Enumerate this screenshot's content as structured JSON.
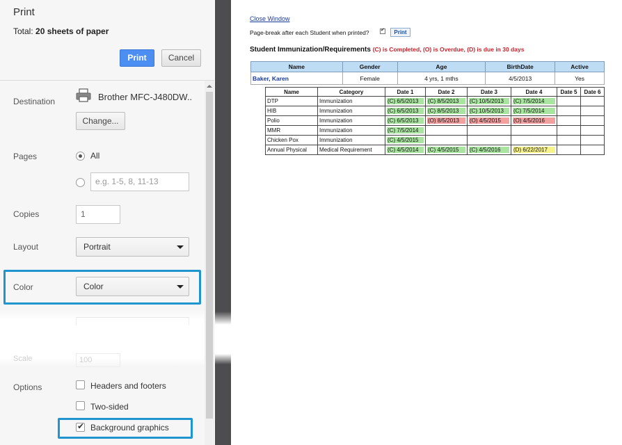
{
  "dialog": {
    "title": "Print",
    "total_prefix": "Total: ",
    "total_value": "20 sheets of paper",
    "print_button": "Print",
    "cancel_button": "Cancel",
    "destination": {
      "label": "Destination",
      "printer_name": "Brother MFC-J480DW..",
      "change_button": "Change..."
    },
    "pages": {
      "label": "Pages",
      "all_label": "All",
      "custom_placeholder": "e.g. 1-5, 8, 11-13"
    },
    "copies": {
      "label": "Copies",
      "value": "1"
    },
    "layout": {
      "label": "Layout",
      "value": "Portrait"
    },
    "color": {
      "label": "Color",
      "value": "Color"
    },
    "scale": {
      "label": "Scale",
      "value": "100"
    },
    "options": {
      "label": "Options",
      "headers_footers": "Headers and footers",
      "two_sided": "Two-sided",
      "background_graphics": "Background graphics"
    }
  },
  "preview": {
    "close_window": "Close Window",
    "pagebreak_label": "Page-break after each Student when printed?",
    "print_button": "Print",
    "report_title": "Student Immunization/Requirements",
    "legend": "(C) is Completed, (O) is Overdue, (D) is due in 30 days",
    "student_headers": [
      "Name",
      "Gender",
      "Age",
      "BirthDate",
      "Active"
    ],
    "student": {
      "name": "Baker, Karen",
      "gender": "Female",
      "age": "4 yrs, 1 mths",
      "birthdate": "4/5/2013",
      "active": "Yes"
    },
    "imm_headers": [
      "Name",
      "Category",
      "Date 1",
      "Date 2",
      "Date 3",
      "Date 4",
      "Date 5",
      "Date 6"
    ],
    "imm_rows": [
      {
        "name": "DTP",
        "category": "Immunization",
        "dates": [
          "(C) 6/5/2013",
          "(C) 8/5/2013",
          "(C) 10/5/2013",
          "(C) 7/5/2014",
          "",
          ""
        ],
        "status": [
          "c",
          "c",
          "c",
          "c",
          "",
          ""
        ]
      },
      {
        "name": "HIB",
        "category": "Immunization",
        "dates": [
          "(C) 6/5/2013",
          "(C) 8/5/2013",
          "(C) 10/5/2013",
          "(C) 7/5/2014",
          "",
          ""
        ],
        "status": [
          "c",
          "c",
          "c",
          "c",
          "",
          ""
        ]
      },
      {
        "name": "Polio",
        "category": "Immunization",
        "dates": [
          "(C) 6/5/2013",
          "(O) 8/5/2013",
          "(O) 4/5/2015",
          "(O) 4/5/2016",
          "",
          ""
        ],
        "status": [
          "c",
          "o",
          "o",
          "o",
          "",
          ""
        ]
      },
      {
        "name": "MMR",
        "category": "Immunization",
        "dates": [
          "(C) 7/5/2014",
          "",
          "",
          "",
          "",
          ""
        ],
        "status": [
          "c",
          "",
          "",
          "",
          "",
          ""
        ]
      },
      {
        "name": "Chicken Pox",
        "category": "Immunization",
        "dates": [
          "(C) 4/5/2015",
          "",
          "",
          "",
          "",
          ""
        ],
        "status": [
          "c",
          "",
          "",
          "",
          "",
          ""
        ]
      },
      {
        "name": "Annual Physical",
        "category": "Medical Requirement",
        "dates": [
          "(C) 4/5/2014",
          "(C) 4/5/2015",
          "(C) 4/5/2016",
          "(D) 6/22/2017",
          "",
          ""
        ],
        "status": [
          "c",
          "c",
          "c",
          "d",
          "",
          ""
        ]
      }
    ]
  }
}
